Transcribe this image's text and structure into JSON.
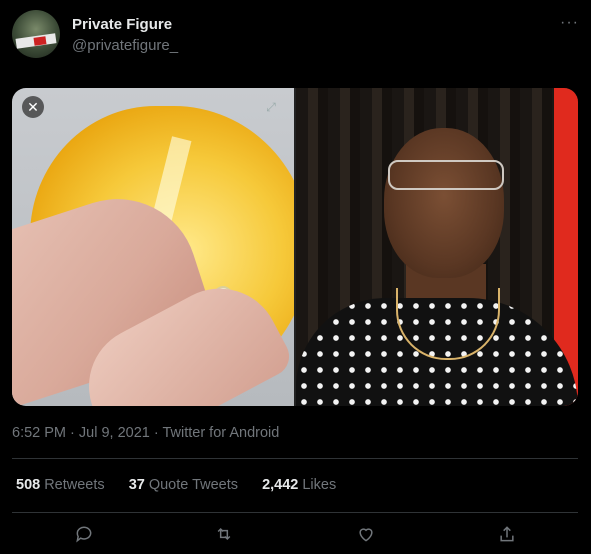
{
  "author": {
    "display_name": "Private Figure",
    "handle": "@privatefigure_",
    "avatar_icon": "avatar-icon"
  },
  "menu": {
    "more_label": "···"
  },
  "media": {
    "close_icon": "close-icon",
    "expand_icon": "expand-icon",
    "images": [
      "lemon-image",
      "woman-reaction-image"
    ]
  },
  "meta": {
    "timestamp": "6:52 PM · Jul 9, 2021 · Twitter for Android"
  },
  "stats": {
    "retweets_count": "508",
    "retweets_label": "Retweets",
    "quotes_count": "37",
    "quotes_label": "Quote Tweets",
    "likes_count": "2,442",
    "likes_label": "Likes"
  },
  "actions": [
    "reply-icon",
    "retweet-icon",
    "like-icon",
    "share-icon"
  ],
  "colors": {
    "background": "#000000",
    "primary_text": "#e7e9ea",
    "secondary_text": "#71767b",
    "divider": "#2f3336"
  }
}
